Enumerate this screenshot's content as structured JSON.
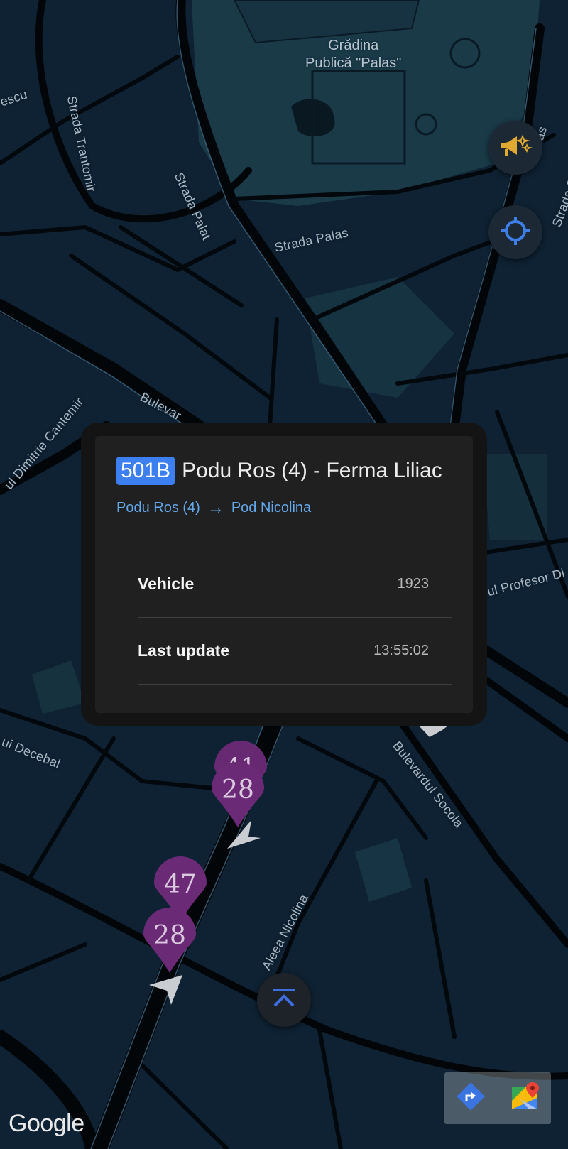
{
  "map": {
    "labels": {
      "park_line1": "Grădina",
      "park_line2": "Publică \"Palas\"",
      "strada_palat": "Strada Palat",
      "strada_palas": "Strada Palas",
      "strada_palas_right": "Palas",
      "strada_trantomir": "Strada Trantomir",
      "escu": "escu",
      "bulevard_top": "Bulevar",
      "dimitrie_cantemir": "ul Dimitrie Cantemir",
      "profesor": "ul Profesor Di",
      "strada_s": "Strada S",
      "decebal": "ui Decebal",
      "bulevardul_socola": "Bulevardul Socola",
      "aleea_nicolina": "Aleea Nicolina"
    },
    "pins": [
      {
        "number": "41"
      },
      {
        "number": "28"
      },
      {
        "number": "47"
      },
      {
        "number": "28"
      }
    ],
    "pin_color": "#6b2a76",
    "water_color": "#0e2233",
    "road_color": "#020609"
  },
  "controls": {
    "announcements_icon": "megaphone-sparkle-icon",
    "locate_icon": "my-location-icon",
    "collapse_icon": "chevron-up-icon",
    "directions_icon": "directions-icon",
    "google_maps_icon": "google-maps-icon"
  },
  "info_card": {
    "route_number": "501B",
    "route_name": "Podu Ros (4) - Ferma Liliac",
    "from_stop": "Podu Ros (4)",
    "to_stop": "Pod Nicolina",
    "rows": [
      {
        "label": "Vehicle",
        "value": "1923"
      },
      {
        "label": "Last update",
        "value": "13:55:02"
      }
    ],
    "badge_color": "#3b7ff1",
    "link_color": "#64a8ec"
  },
  "footer": {
    "google_logo": "Google"
  }
}
